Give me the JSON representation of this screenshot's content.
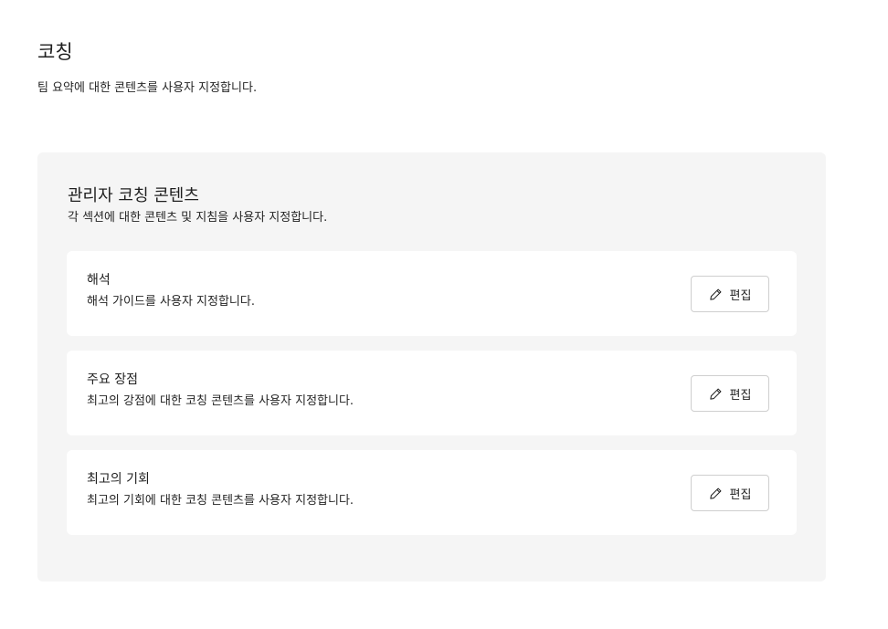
{
  "header": {
    "title": "코칭",
    "subtitle": "팀 요약에 대한 콘텐츠를 사용자 지정합니다."
  },
  "panel": {
    "title": "관리자 코칭 콘텐츠",
    "subtitle": "각 섹션에 대한 콘텐츠 및 지침을 사용자 지정합니다.",
    "cards": [
      {
        "title": "해석",
        "description": "해석 가이드를 사용자 지정합니다.",
        "button_label": "편집",
        "button_icon": "pencil-icon"
      },
      {
        "title": "주요 장점",
        "description": "최고의 강점에 대한 코칭 콘텐츠를 사용자 지정합니다.",
        "button_label": "편집",
        "button_icon": "pencil-icon"
      },
      {
        "title": "최고의 기회",
        "description": "최고의 기회에 대한 코칭 콘텐츠를 사용자 지정합니다.",
        "button_label": "편집",
        "button_icon": "pencil-icon"
      }
    ]
  },
  "colors": {
    "panel_background": "#f5f5f5",
    "card_background": "#ffffff",
    "button_border": "#cfcfcf",
    "text": "#1f1f1f"
  }
}
